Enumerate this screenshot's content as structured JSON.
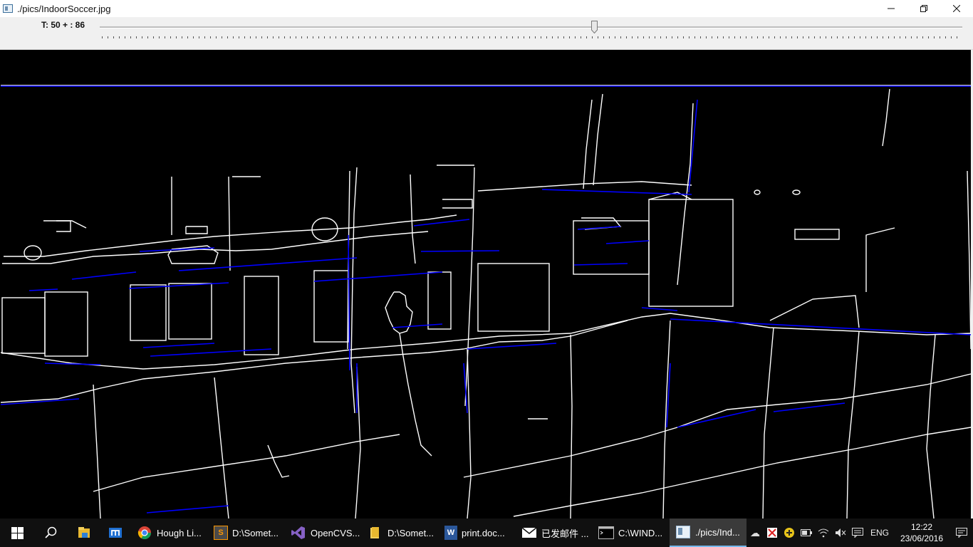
{
  "window": {
    "title": "./pics/IndoorSoccer.jpg",
    "minimize_glyph": "—",
    "maximize_glyph": "❐",
    "close_glyph": "✕"
  },
  "trackbar": {
    "label": "T: 50 + : 86",
    "value": 86
  },
  "canvas": {
    "description_colors": {
      "background": "#000000",
      "edges": "#ffffff",
      "hough_lines": "#0000ff"
    }
  },
  "taskbar": {
    "tasks": [
      {
        "label": "Hough Li...",
        "icon": "chrome-icon"
      },
      {
        "label": "D:\\Somet...",
        "icon": "sublime-icon"
      },
      {
        "label": "OpenCVS...",
        "icon": "visual-studio-icon"
      },
      {
        "label": "D:\\Somet...",
        "icon": "folder-icon"
      },
      {
        "label": "print.doc...",
        "icon": "word-icon"
      },
      {
        "label": "已发邮件 ...",
        "icon": "mail-icon"
      },
      {
        "label": "C:\\WIND...",
        "icon": "console-icon"
      },
      {
        "label": "./pics/Ind...",
        "icon": "opencv-window-icon"
      }
    ],
    "language": "ENG",
    "time": "12:22",
    "date": "23/06/2016",
    "accent_color": "#76b9ed"
  }
}
